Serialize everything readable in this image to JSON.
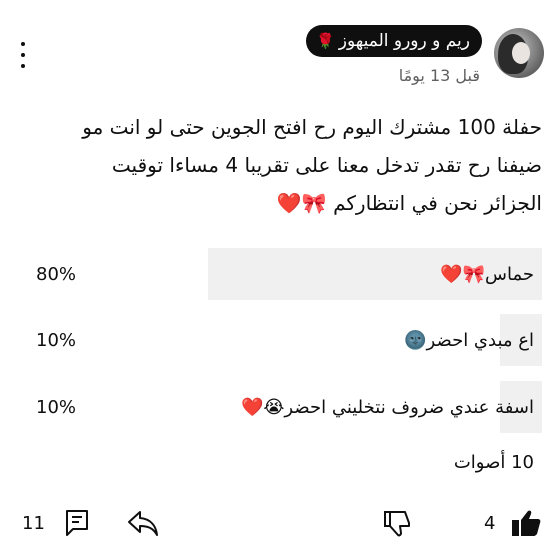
{
  "author": {
    "name": "ريم و رورو الميهوز",
    "badge_icon": "rose-icon"
  },
  "timestamp": "قبل 13 يومًا",
  "post_text": "حفلة 100 مشترك اليوم رح افتح الجوين حتى لو انت مو\nضيفنا رح تقدر تدخل معنا على تقريبا 4 مساءا توقيت\nالجزائر نحن في انتظاركم 🎀❤️",
  "poll": {
    "options": [
      {
        "label": "حماس🎀❤️",
        "percent": "80%",
        "fraction": 0.8
      },
      {
        "label": "اع مبدي احضر🌚",
        "percent": "10%",
        "fraction": 0.1
      },
      {
        "label": "اسفة عندي ضروف نتخليني احضر😭❤️",
        "percent": "10%",
        "fraction": 0.1
      }
    ],
    "total_votes": "10 أصوات"
  },
  "actions": {
    "like_count": "4",
    "comment_count": "11"
  },
  "colors": {
    "text": "#0f0f0f",
    "secondary_text": "#606060",
    "poll_fill": "#f0f0f0",
    "chip_background": "#0f0f0f"
  }
}
